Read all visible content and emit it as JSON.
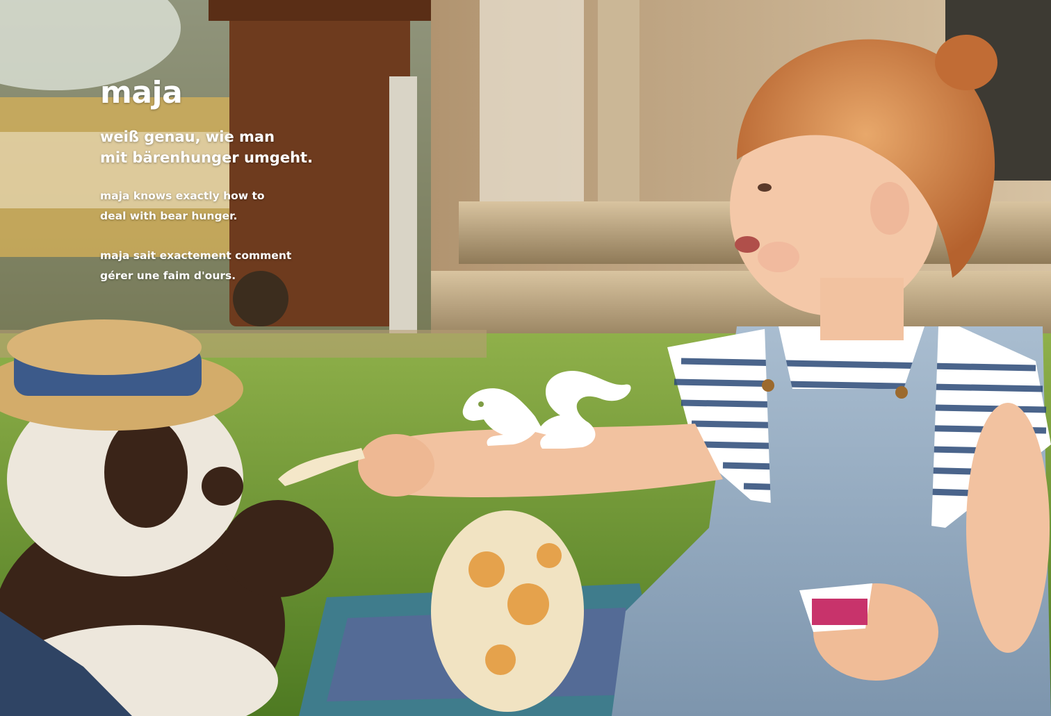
{
  "hero": {
    "name": "maja",
    "headline_de": [
      "weiß genau, wie man",
      "mit bärenhunger umgeht."
    ],
    "text_en": [
      "maja knows exactly how to",
      "deal with bear hunger."
    ],
    "text_fr": [
      "maja sait exactement comment",
      "gérer une faim d'ours."
    ]
  },
  "logo": {
    "icon": "squirrel-icon",
    "color": "#ffffff"
  }
}
